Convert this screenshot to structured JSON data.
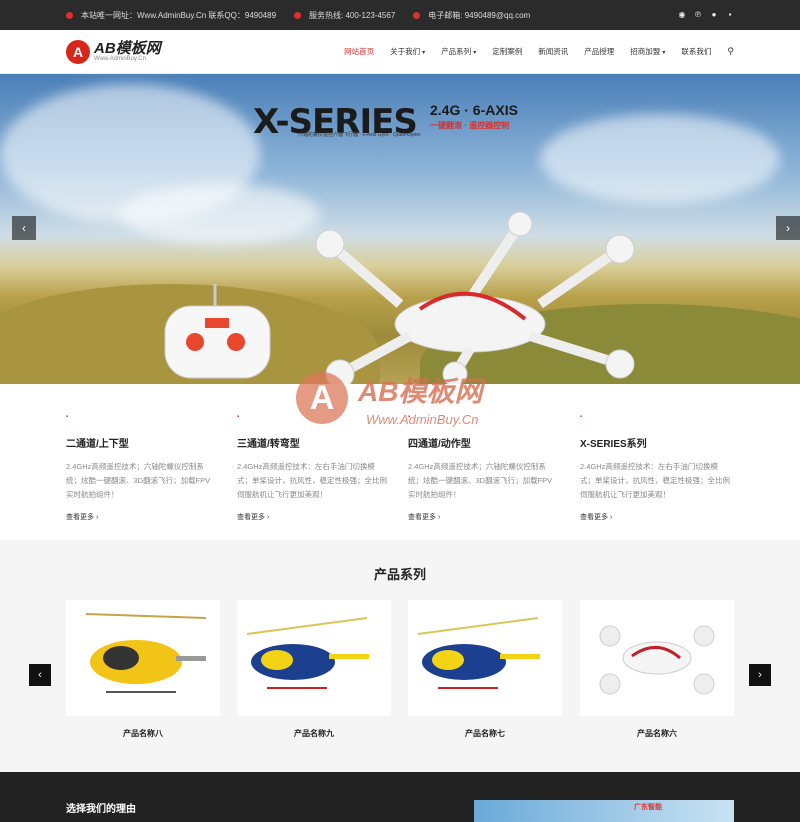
{
  "topbar": {
    "site": "本站唯一网址：Www.AdminBuy.Cn 联系QQ：9490489",
    "hotline": "服务热线: 400-123-4567",
    "email": "电子邮箱: 9490489@qq.com"
  },
  "header": {
    "logo_mark": "A",
    "logo_name": "AB模板网",
    "logo_url": "Www.AdminBuy.Cn",
    "nav": [
      {
        "label": "网站首页",
        "active": true,
        "dropdown": false
      },
      {
        "label": "关于我们",
        "active": false,
        "dropdown": true
      },
      {
        "label": "产品系列",
        "active": false,
        "dropdown": true
      },
      {
        "label": "定制案例",
        "active": false,
        "dropdown": false
      },
      {
        "label": "新闻资讯",
        "active": false,
        "dropdown": false
      },
      {
        "label": "产品授理",
        "active": false,
        "dropdown": false
      },
      {
        "label": "招商加盟",
        "active": false,
        "dropdown": true
      },
      {
        "label": "联系我们",
        "active": false,
        "dropdown": false
      }
    ]
  },
  "banner": {
    "headline": "X-SERIES",
    "headline_sub": "2.4G · 6-AXIS",
    "headline_red": "一键翻滚  · 遥控器控制",
    "headline_small": "六轴陀螺仪遥控六轴飞行器 · 6-Axis Gyro · Quad-copter",
    "prev": "‹",
    "next": "›"
  },
  "features": [
    {
      "title": "二通道/上下型",
      "desc": "2.4GHz高频遥控技术；六轴陀螺仪控制系统；炫酷一键翻滚、3D翻滚飞行；加载FPV实时航拍组件！",
      "more": "查看更多"
    },
    {
      "title": "三通道/转弯型",
      "desc": "2.4GHz高频遥控技术：左右手油门切换模式；单桨设计，抗风性，稳定性极强；全比例伺服航机让飞行更加美观！",
      "more": "查看更多"
    },
    {
      "title": "四通道/动作型",
      "desc": "2.4GHz高频遥控技术；六轴陀螺仪控制系统；炫酷一键翻滚、3D翻滚飞行；加载FPV实时航拍组件！",
      "more": "查看更多"
    },
    {
      "title": "X-SERIES系列",
      "desc": "2.4GHz高频遥控技术：左右手油门切换模式；单桨设计，抗风性，稳定性极强；全比例伺服航机让飞行更加美观！",
      "more": "查看更多"
    }
  ],
  "watermark": {
    "mark": "A",
    "text": "AB模板网",
    "url": "Www.AdminBuy.Cn"
  },
  "products": {
    "title": "产品系列",
    "items": [
      {
        "name": "产品名称八"
      },
      {
        "name": "产品名称九"
      },
      {
        "name": "产品名称七"
      },
      {
        "name": "产品名称六"
      }
    ],
    "prev": "‹",
    "next": "›"
  },
  "why": {
    "title": "选择我们的理由",
    "tag": "广东智能"
  },
  "colors": {
    "accent": "#d9322f",
    "topbar_bg": "#2b2b2b",
    "footer_bg": "#222222"
  }
}
